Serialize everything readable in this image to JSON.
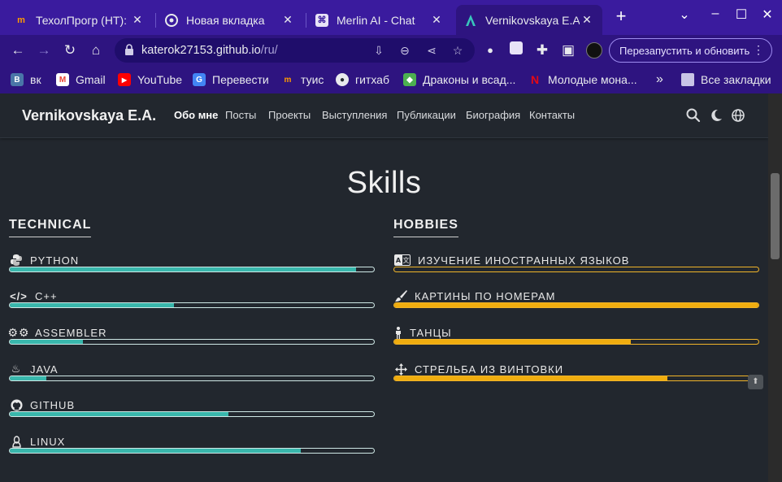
{
  "browser": {
    "tabs": [
      {
        "title": "ТехолПрогр (НТ): З",
        "favicon": "notion-m-icon",
        "active": false
      },
      {
        "title": "Новая вкладка",
        "favicon": "chrome-icon",
        "active": false
      },
      {
        "title": "Merlin AI - Chat",
        "favicon": "merlin-icon",
        "active": false
      },
      {
        "title": "Vernikovskaya E.A.",
        "favicon": "site-logo-icon",
        "active": true
      }
    ],
    "new_tab_symbol": "+",
    "url_host": "katerok27153.github.io",
    "url_path": "/ru/",
    "relaunch_label": "Перезапустить и обновить",
    "bookmarks": [
      {
        "label": "вк",
        "icon": "vk-icon",
        "color": "#4a76a8"
      },
      {
        "label": "Gmail",
        "icon": "gmail-icon",
        "color": "#ea4335"
      },
      {
        "label": "YouTube",
        "icon": "youtube-icon",
        "color": "#ff0000"
      },
      {
        "label": "Перевести",
        "icon": "google-translate-icon",
        "color": "#4285f4"
      },
      {
        "label": "туис",
        "icon": "tuis-icon",
        "color": "#ff9a00"
      },
      {
        "label": "гитхаб",
        "icon": "github-icon",
        "color": "#24292e"
      },
      {
        "label": "Драконы и всад...",
        "icon": "dragons-icon",
        "color": "#4caf50"
      },
      {
        "label": "Молодые мона...",
        "icon": "netflix-icon",
        "color": "#e50914"
      }
    ],
    "all_bookmarks_label": "Все закладки"
  },
  "site": {
    "brand": "Vernikovskaya E.A.",
    "nav": [
      {
        "label": "Обо мне",
        "active": true
      },
      {
        "label": "Посты",
        "active": false
      },
      {
        "label": "Проекты",
        "active": false
      },
      {
        "label": "Выступления",
        "active": false
      },
      {
        "label": "Публикации",
        "active": false
      },
      {
        "label": "Биография",
        "active": false
      },
      {
        "label": "Контакты",
        "active": false
      }
    ]
  },
  "skills": {
    "title": "Skills",
    "technical": {
      "title": "TECHNICAL",
      "color": "#39b7ac",
      "items": [
        {
          "label": "PYTHON",
          "icon": "python-icon",
          "level": 95
        },
        {
          "label": "C++",
          "icon": "code-icon",
          "level": 45
        },
        {
          "label": "ASSEMBLER",
          "icon": "gears-icon",
          "level": 20
        },
        {
          "label": "JAVA",
          "icon": "java-icon",
          "level": 10
        },
        {
          "label": "GITHUB",
          "icon": "github-icon",
          "level": 60
        },
        {
          "label": "LINUX",
          "icon": "linux-icon",
          "level": 80
        }
      ]
    },
    "hobbies": {
      "title": "HOBBIES",
      "color": "#f0ad0f",
      "items": [
        {
          "label": "ИЗУЧЕНИЕ ИНОСТРАННЫХ ЯЗЫКОВ",
          "icon": "language-icon",
          "level": 0
        },
        {
          "label": "КАРТИНЫ ПО НОМЕРАМ",
          "icon": "paint-brush-icon",
          "level": 100
        },
        {
          "label": "ТАНЦЫ",
          "icon": "person-icon",
          "level": 65
        },
        {
          "label": "СТРЕЛЬБА ИЗ ВИНТОВКИ",
          "icon": "arrows-move-icon",
          "level": 75
        }
      ]
    }
  }
}
